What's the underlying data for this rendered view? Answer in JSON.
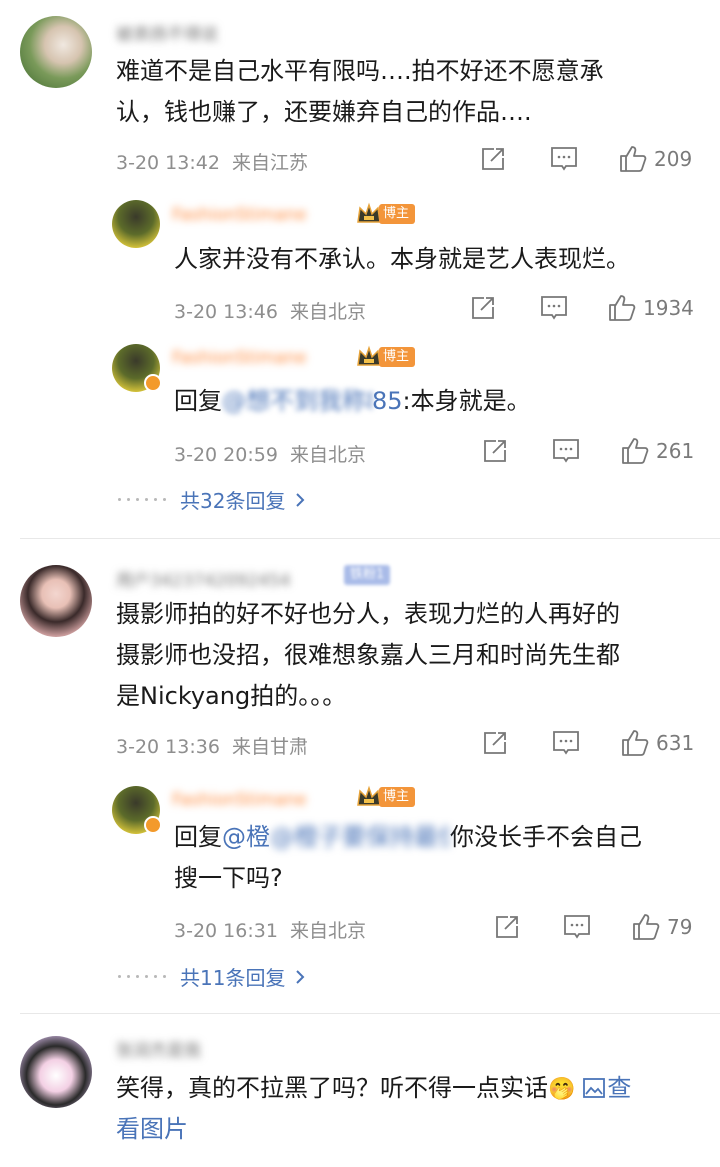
{
  "comments": [
    {
      "username": "被表扬不得说",
      "text_lines": [
        "难道不是自己水平有限吗….拍不好还不愿意承",
        "认，钱也赚了，还要嫌弃自己的作品…."
      ],
      "date": "3-20 13:42",
      "location": "来自江苏",
      "likes": "209"
    },
    {
      "username": "用户3423742092454",
      "fan_badge": "铁粉1",
      "text_lines": [
        "摄影师拍的好不好也分人，表现力烂的人再好的",
        "摄影师也没招，很难想象嘉人三月和时尚先生都",
        "是Nickyang拍的。。。"
      ],
      "date": "3-20 13:36",
      "location": "来自甘肃",
      "likes": "631"
    },
    {
      "username": "张润杰是我",
      "text_line1": "笑得，真的不拉黑了吗？听不得一点实话",
      "emoji": "🤭",
      "view_image": "查看图片",
      "view_image_line1": "查",
      "view_image_line2": "看图片"
    }
  ],
  "replies": [
    {
      "username": "FashionStimane",
      "badge": "博主",
      "text": "人家并没有不承认。本身就是艺人表现烂。",
      "date": "3-20 13:46",
      "location": "来自北京",
      "likes": "1934"
    },
    {
      "username": "FashionStimane",
      "badge": "博主",
      "reply_prefix": "回复",
      "mention": "@想不到我称85",
      "mention_visible_end": "85",
      "rest": ":本身就是。",
      "date": "3-20 20:59",
      "location": "来自北京",
      "likes": "261"
    },
    {
      "username": "FashionStimane",
      "badge": "博主",
      "reply_prefix": "回复",
      "mention": "@橙子要保持最佳状态",
      "mention_visible": "@橙",
      "rest_line1": "你没长手不会自己",
      "rest_line2": "搜一下吗?",
      "date": "3-20 16:31",
      "location": "来自北京",
      "likes": "79"
    }
  ],
  "threads": {
    "more1": "共32条回复",
    "more2": "共11条回复"
  },
  "colors": {
    "link": "#4a74b8",
    "meta": "#8e8e8e",
    "badge": "#f3953a",
    "fan_badge": "#a9bbe8"
  },
  "icons": [
    "share-icon",
    "comment-icon",
    "like-icon",
    "chevron-right-icon",
    "crown-icon",
    "image-icon"
  ]
}
